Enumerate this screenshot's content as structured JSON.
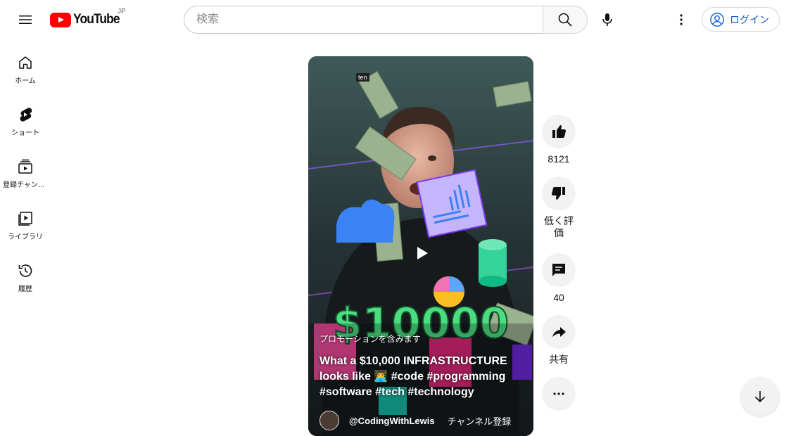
{
  "header": {
    "logo_text": "YouTube",
    "logo_region": "JP",
    "search_placeholder": "検索",
    "login_label": "ログイン"
  },
  "sidebar": {
    "items": [
      {
        "label": "ホーム",
        "icon": "home-icon"
      },
      {
        "label": "ショート",
        "icon": "shorts-icon"
      },
      {
        "label": "登録チャンネル",
        "icon": "subscriptions-icon"
      },
      {
        "label": "ライブラリ",
        "icon": "library-icon"
      },
      {
        "label": "履歴",
        "icon": "history-icon"
      }
    ]
  },
  "video": {
    "overlay_tag": "ten",
    "promo_label": "プロモーションを含みます",
    "title": "What a $10,000 INFRASTRUCTURE looks like 👨‍💻 #code #programming #software #tech #technology",
    "thumbnail_text": "$10000",
    "channel_name": "@CodingWithLewis",
    "subscribe_label": "チャンネル登録"
  },
  "actions": {
    "like_count": "8121",
    "dislike_label": "低く評価",
    "comment_count": "40",
    "share_label": "共有"
  },
  "colors": {
    "brand_red": "#ff0000",
    "link_blue": "#065fd4"
  }
}
